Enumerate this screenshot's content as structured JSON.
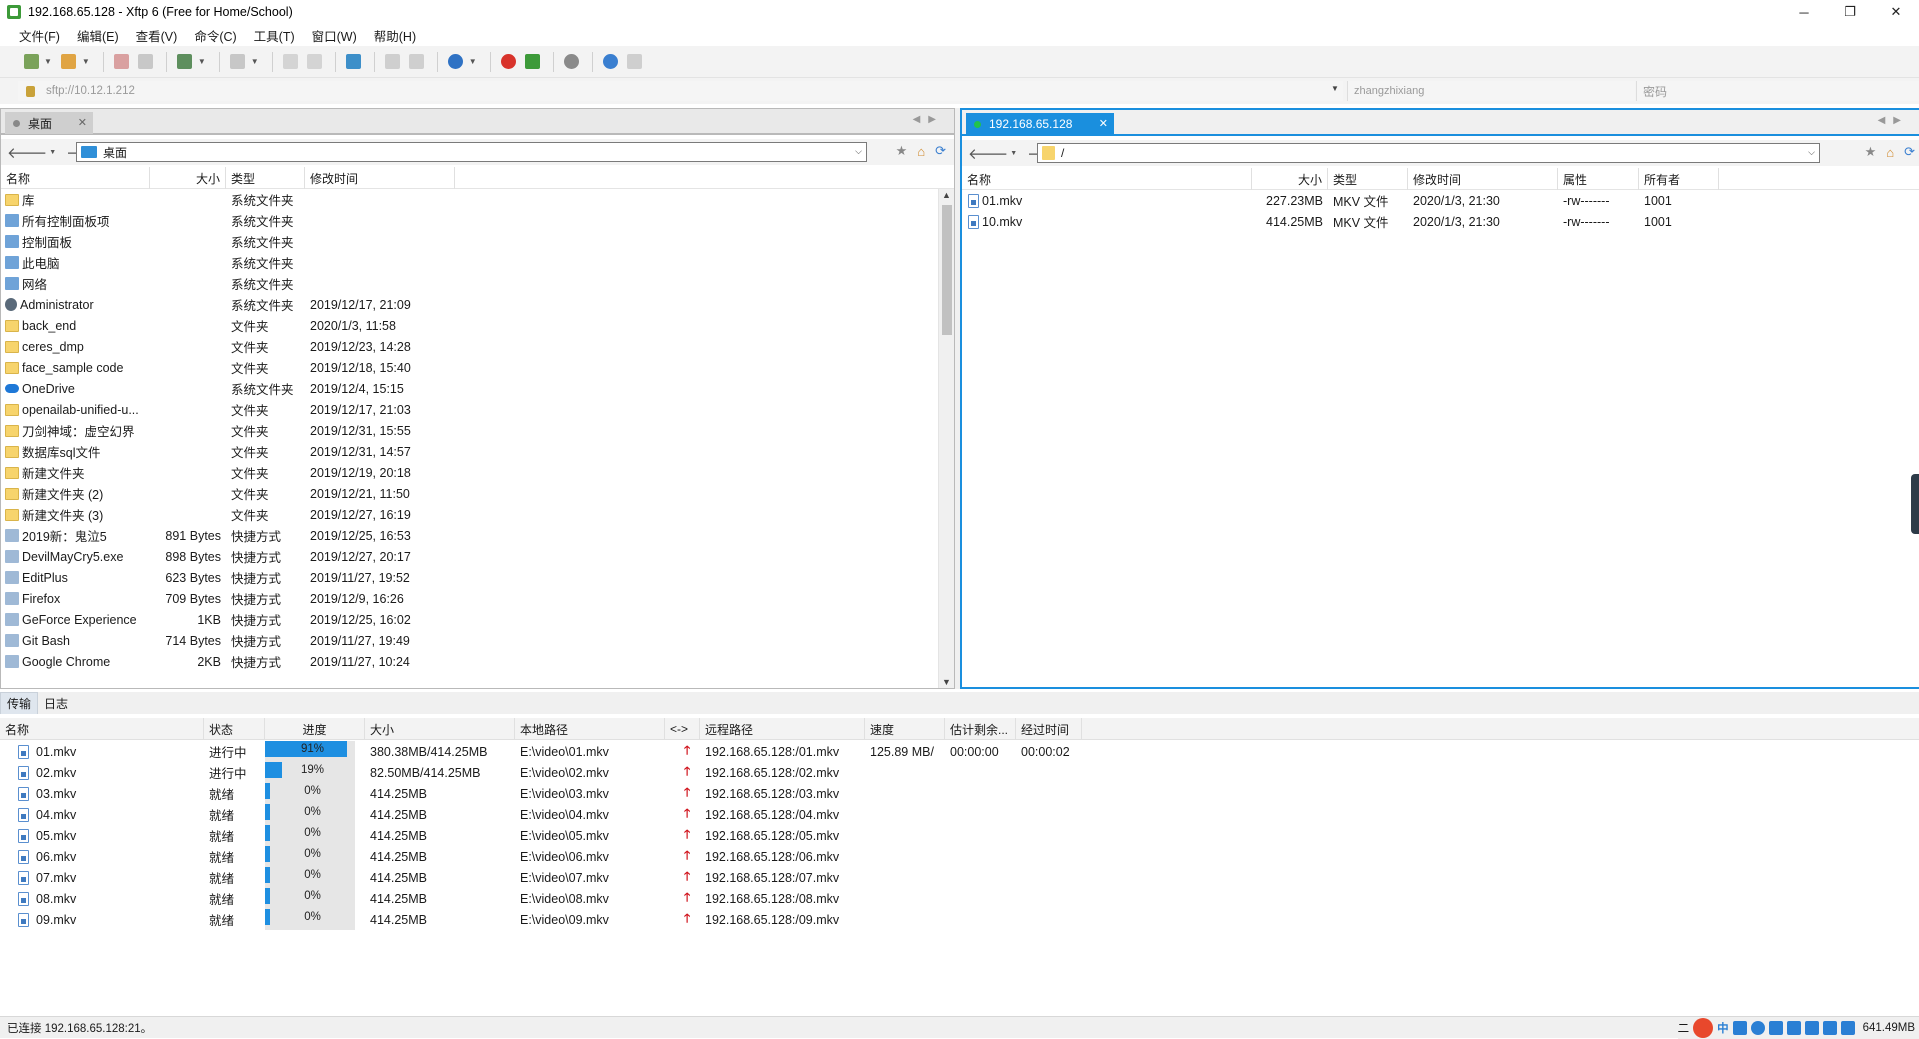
{
  "window": {
    "title": "192.168.65.128 - Xftp 6 (Free for Home/School)",
    "minimize": "─",
    "restore": "❐",
    "close": "✕"
  },
  "menu": [
    "文件(F)",
    "编辑(E)",
    "查看(V)",
    "命令(C)",
    "工具(T)",
    "窗口(W)",
    "帮助(H)"
  ],
  "address": {
    "url": "sftp://10.12.1.212",
    "user_placeholder": "zhangzhixiang",
    "password_placeholder": "密码"
  },
  "local": {
    "tab": "桌面",
    "path": "桌面",
    "columns": [
      "名称",
      "大小",
      "类型",
      "修改时间"
    ],
    "files": [
      {
        "icon": "folder",
        "name": "库",
        "size": "",
        "type": "系统文件夹",
        "modified": ""
      },
      {
        "icon": "sys",
        "name": "所有控制面板项",
        "size": "",
        "type": "系统文件夹",
        "modified": ""
      },
      {
        "icon": "sys",
        "name": "控制面板",
        "size": "",
        "type": "系统文件夹",
        "modified": ""
      },
      {
        "icon": "sys",
        "name": "此电脑",
        "size": "",
        "type": "系统文件夹",
        "modified": ""
      },
      {
        "icon": "sys",
        "name": "网络",
        "size": "",
        "type": "系统文件夹",
        "modified": ""
      },
      {
        "icon": "user",
        "name": "Administrator",
        "size": "",
        "type": "系统文件夹",
        "modified": "2019/12/17, 21:09"
      },
      {
        "icon": "folder",
        "name": "back_end",
        "size": "",
        "type": "文件夹",
        "modified": "2020/1/3, 11:58"
      },
      {
        "icon": "folder",
        "name": "ceres_dmp",
        "size": "",
        "type": "文件夹",
        "modified": "2019/12/23, 14:28"
      },
      {
        "icon": "folder",
        "name": "face_sample code",
        "size": "",
        "type": "文件夹",
        "modified": "2019/12/18, 15:40"
      },
      {
        "icon": "cloud",
        "name": "OneDrive",
        "size": "",
        "type": "系统文件夹",
        "modified": "2019/12/4, 15:15"
      },
      {
        "icon": "folder",
        "name": "openailab-unified-u...",
        "size": "",
        "type": "文件夹",
        "modified": "2019/12/17, 21:03"
      },
      {
        "icon": "folder",
        "name": "刀剑神域：虚空幻界",
        "size": "",
        "type": "文件夹",
        "modified": "2019/12/31, 15:55"
      },
      {
        "icon": "folder",
        "name": "数据库sql文件",
        "size": "",
        "type": "文件夹",
        "modified": "2019/12/31, 14:57"
      },
      {
        "icon": "folder",
        "name": "新建文件夹",
        "size": "",
        "type": "文件夹",
        "modified": "2019/12/19, 20:18"
      },
      {
        "icon": "folder",
        "name": "新建文件夹 (2)",
        "size": "",
        "type": "文件夹",
        "modified": "2019/12/21, 11:50"
      },
      {
        "icon": "folder",
        "name": "新建文件夹 (3)",
        "size": "",
        "type": "文件夹",
        "modified": "2019/12/27, 16:19"
      },
      {
        "icon": "lnk",
        "name": "2019新：鬼泣5",
        "size": "891 Bytes",
        "type": "快捷方式",
        "modified": "2019/12/25, 16:53"
      },
      {
        "icon": "lnk",
        "name": "DevilMayCry5.exe",
        "size": "898 Bytes",
        "type": "快捷方式",
        "modified": "2019/12/27, 20:17"
      },
      {
        "icon": "lnk",
        "name": "EditPlus",
        "size": "623 Bytes",
        "type": "快捷方式",
        "modified": "2019/11/27, 19:52"
      },
      {
        "icon": "lnk",
        "name": "Firefox",
        "size": "709 Bytes",
        "type": "快捷方式",
        "modified": "2019/12/9, 16:26"
      },
      {
        "icon": "lnk",
        "name": "GeForce Experience",
        "size": "1KB",
        "type": "快捷方式",
        "modified": "2019/12/25, 16:02"
      },
      {
        "icon": "lnk",
        "name": "Git Bash",
        "size": "714 Bytes",
        "type": "快捷方式",
        "modified": "2019/11/27, 19:49"
      },
      {
        "icon": "lnk",
        "name": "Google Chrome",
        "size": "2KB",
        "type": "快捷方式",
        "modified": "2019/11/27, 10:24"
      }
    ]
  },
  "remote": {
    "tab": "192.168.65.128",
    "path": "/",
    "columns": [
      "名称",
      "大小",
      "类型",
      "修改时间",
      "属性",
      "所有者"
    ],
    "files": [
      {
        "name": "01.mkv",
        "size": "227.23MB",
        "type": "MKV 文件",
        "modified": "2020/1/3, 21:30",
        "attr": "-rw-------",
        "owner": "1001"
      },
      {
        "name": "10.mkv",
        "size": "414.25MB",
        "type": "MKV 文件",
        "modified": "2020/1/3, 21:30",
        "attr": "-rw-------",
        "owner": "1001"
      }
    ]
  },
  "transfer": {
    "tabs": [
      "传输",
      "日志"
    ],
    "columns": [
      "名称",
      "状态",
      "进度",
      "大小",
      "本地路径",
      "<->",
      "远程路径",
      "速度",
      "估计剩余...",
      "经过时间"
    ],
    "items": [
      {
        "name": "01.mkv",
        "status": "进行中",
        "progress": 91,
        "progress_label": "91%",
        "size": "380.38MB/414.25MB",
        "local": "E:\\video\\01.mkv",
        "remote": "192.168.65.128:/01.mkv",
        "speed": "125.89 MB/",
        "eta": "00:00:00",
        "elapsed": "00:00:02"
      },
      {
        "name": "02.mkv",
        "status": "进行中",
        "progress": 19,
        "progress_label": "19%",
        "size": "82.50MB/414.25MB",
        "local": "E:\\video\\02.mkv",
        "remote": "192.168.65.128:/02.mkv",
        "speed": "",
        "eta": "",
        "elapsed": ""
      },
      {
        "name": "03.mkv",
        "status": "就绪",
        "progress": 0,
        "progress_label": "0%",
        "size": "414.25MB",
        "local": "E:\\video\\03.mkv",
        "remote": "192.168.65.128:/03.mkv",
        "speed": "",
        "eta": "",
        "elapsed": ""
      },
      {
        "name": "04.mkv",
        "status": "就绪",
        "progress": 0,
        "progress_label": "0%",
        "size": "414.25MB",
        "local": "E:\\video\\04.mkv",
        "remote": "192.168.65.128:/04.mkv",
        "speed": "",
        "eta": "",
        "elapsed": ""
      },
      {
        "name": "05.mkv",
        "status": "就绪",
        "progress": 0,
        "progress_label": "0%",
        "size": "414.25MB",
        "local": "E:\\video\\05.mkv",
        "remote": "192.168.65.128:/05.mkv",
        "speed": "",
        "eta": "",
        "elapsed": ""
      },
      {
        "name": "06.mkv",
        "status": "就绪",
        "progress": 0,
        "progress_label": "0%",
        "size": "414.25MB",
        "local": "E:\\video\\06.mkv",
        "remote": "192.168.65.128:/06.mkv",
        "speed": "",
        "eta": "",
        "elapsed": ""
      },
      {
        "name": "07.mkv",
        "status": "就绪",
        "progress": 0,
        "progress_label": "0%",
        "size": "414.25MB",
        "local": "E:\\video\\07.mkv",
        "remote": "192.168.65.128:/07.mkv",
        "speed": "",
        "eta": "",
        "elapsed": ""
      },
      {
        "name": "08.mkv",
        "status": "就绪",
        "progress": 0,
        "progress_label": "0%",
        "size": "414.25MB",
        "local": "E:\\video\\08.mkv",
        "remote": "192.168.65.128:/08.mkv",
        "speed": "",
        "eta": "",
        "elapsed": ""
      },
      {
        "name": "09.mkv",
        "status": "就绪",
        "progress": 0,
        "progress_label": "0%",
        "size": "414.25MB",
        "local": "E:\\video\\09.mkv",
        "remote": "192.168.65.128:/09.mkv",
        "speed": "",
        "eta": "",
        "elapsed": ""
      }
    ]
  },
  "status": {
    "text": "已连接 192.168.65.128:21。",
    "tray_lang": "中",
    "memory": "641.49MB",
    "tray_prefix": "二"
  },
  "colors": {
    "accent": "#1a8fde",
    "progress_fill": "#1e8fe1",
    "upload_arrow": "#d0121b",
    "folder": "#f7d46c"
  }
}
